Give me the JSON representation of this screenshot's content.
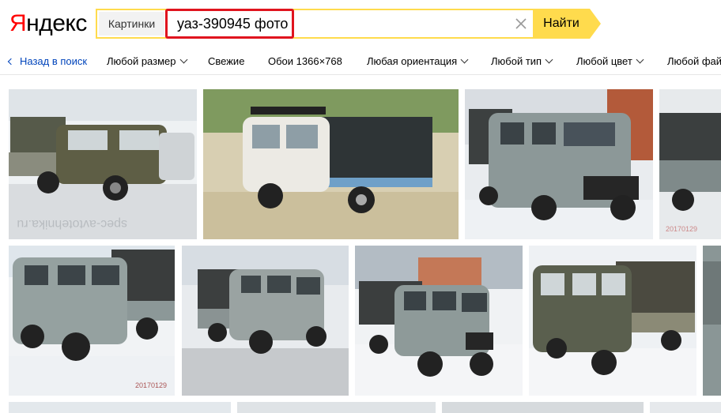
{
  "logo": {
    "first": "Я",
    "rest": "ндекс"
  },
  "search": {
    "service_tab": "Картинки",
    "query": "уаз-390945 фото",
    "submit_label": "Найти"
  },
  "filters": {
    "back": "Назад в поиск",
    "items": [
      "Любой размер",
      "Свежие",
      "Обои 1366×768",
      "Любая ориентация",
      "Любой тип",
      "Любой цвет",
      "Любой фай"
    ]
  },
  "images": {
    "watermarks": [
      "spec-avtotehnika.ru",
      "20170129",
      "20170129",
      "20170129"
    ]
  },
  "colors": {
    "brand_red": "#ff0000",
    "search_yellow": "#ffdb4d",
    "highlight_red": "#e0141e",
    "link_blue": "#0044bb"
  }
}
